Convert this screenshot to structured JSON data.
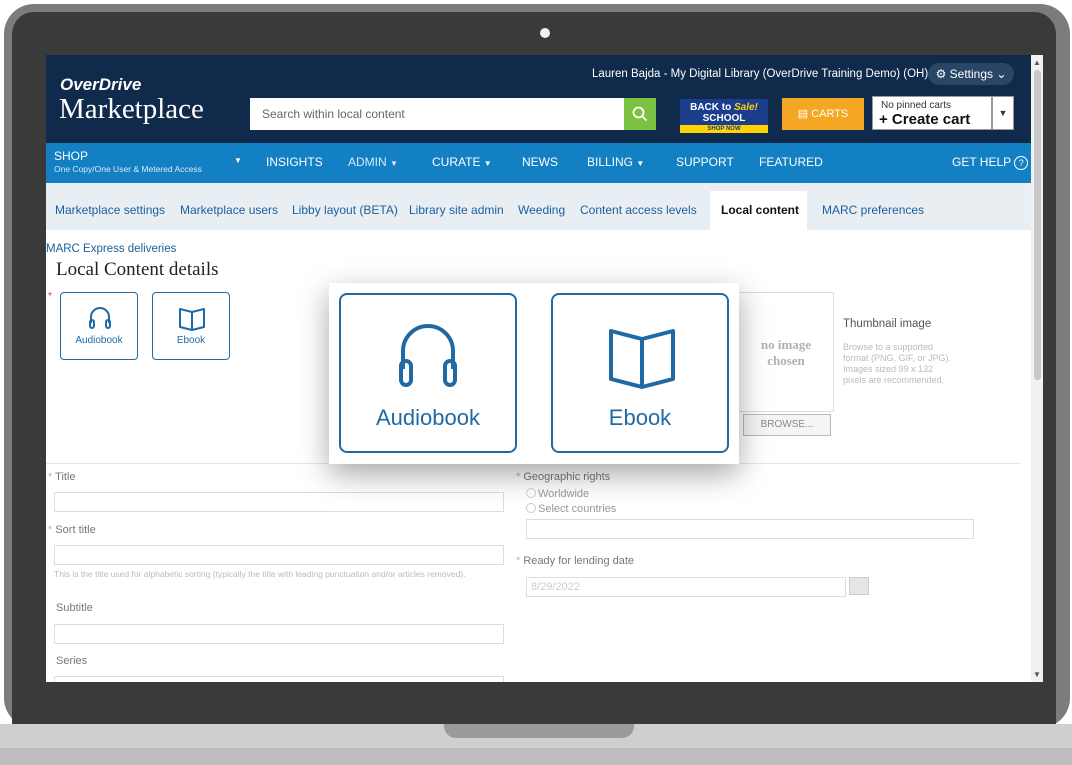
{
  "header": {
    "logo_top": "OverDrive",
    "logo_bottom": "Marketplace",
    "user_line": "Lauren Bajda - My Digital Library (OverDrive Training Demo) (OH)",
    "settings_label": "Settings",
    "search_placeholder": "Search within local content",
    "banner_line1": "BACK to",
    "banner_sale": "Sale!",
    "banner_line2": "SCHOOL",
    "banner_shop": "SHOP NOW",
    "carts_label": "CARTS",
    "pinned_carts": "No pinned carts",
    "create_cart": "+ Create cart"
  },
  "nav": {
    "shop_title": "SHOP",
    "shop_sub": "One Copy/One User & Metered Access",
    "items": [
      "INSIGHTS",
      "ADMIN",
      "CURATE",
      "NEWS",
      "BILLING",
      "SUPPORT",
      "FEATURED"
    ],
    "get_help": "GET HELP"
  },
  "tabs": {
    "items": [
      "Marketplace settings",
      "Marketplace users",
      "Libby layout (BETA)",
      "Library site admin",
      "Weeding",
      "Content access levels"
    ],
    "active": "Local content",
    "after": "MARC preferences"
  },
  "content": {
    "marc_link": "MARC Express deliveries",
    "page_title": "Local Content details",
    "format_audiobook": "Audiobook",
    "format_ebook": "Ebook",
    "thumb_placeholder_1": "no image",
    "thumb_placeholder_2": "chosen",
    "thumb_title": "Thumbnail image",
    "thumb_help": "Browse to a supported format (PNG, GIF, or JPG). Images sized 99 x 132 pixels are recommended.",
    "browse_label": "BROWSE...",
    "title_label": "Title",
    "sort_title_label": "Sort title",
    "sort_title_help": "This is the title used for alphabetic sorting (typically the title with leading punctuation and/or articles removed).",
    "subtitle_label": "Subtitle",
    "series_label": "Series",
    "geo_label": "Geographic rights",
    "geo_worldwide": "Worldwide",
    "geo_select": "Select countries",
    "lending_label": "Ready for lending date",
    "lending_value": "8/29/2022"
  },
  "callout": {
    "audiobook": "Audiobook",
    "ebook": "Ebook"
  },
  "colors": {
    "header_bg": "#0f2a4a",
    "nav_bg": "#1380c4",
    "accent": "#1f6aa5",
    "search_green": "#7cc142",
    "carts_orange": "#f5a623"
  }
}
